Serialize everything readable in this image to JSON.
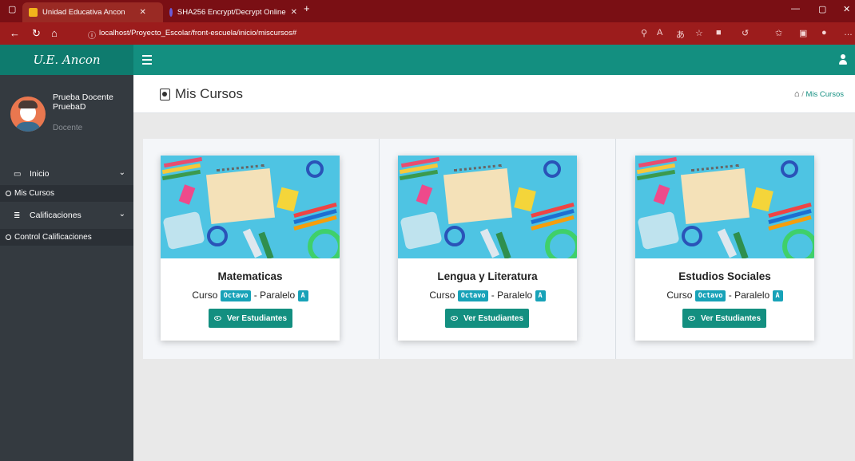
{
  "browser": {
    "tabs": [
      {
        "title": "Unidad Educativa Ancon"
      },
      {
        "title": "SHA256 Encrypt/Decrypt Online"
      }
    ],
    "new_tab": "+",
    "url": "localhost/Proyecto_Escolar/front-escuela/inicio/miscursos#"
  },
  "app": {
    "brand": "U.E. Ancon"
  },
  "sidebar": {
    "user_name_line1": "Prueba Docente",
    "user_name_line2": "PruebaD",
    "user_role": "Docente",
    "menu": [
      {
        "label": "Inicio",
        "icon": "monitor-icon"
      },
      {
        "label": "Calificaciones",
        "icon": "list-icon"
      }
    ],
    "submenu": [
      {
        "label": "Mis Cursos"
      },
      {
        "label": "Control Calificaciones"
      }
    ]
  },
  "page": {
    "title": "Mis Cursos",
    "breadcrumb_sep": "/",
    "breadcrumb_current": "Mis Cursos"
  },
  "courses": [
    {
      "name": "Matematicas",
      "curso_label": "Curso",
      "curso": "Octavo",
      "paralelo_label": "- Paralelo",
      "paralelo": "A",
      "button": "Ver Estudiantes"
    },
    {
      "name": "Lengua y Literatura",
      "curso_label": "Curso",
      "curso": "Octavo",
      "paralelo_label": "- Paralelo",
      "paralelo": "A",
      "button": "Ver Estudiantes"
    },
    {
      "name": "Estudios Sociales",
      "curso_label": "Curso",
      "curso": "Octavo",
      "paralelo_label": "- Paralelo",
      "paralelo": "A",
      "button": "Ver Estudiantes"
    }
  ],
  "colors": {
    "primary": "#138f80",
    "badge": "#17a2b8",
    "sidebar": "#343a40",
    "browser_frame": "#9c1c1c"
  }
}
